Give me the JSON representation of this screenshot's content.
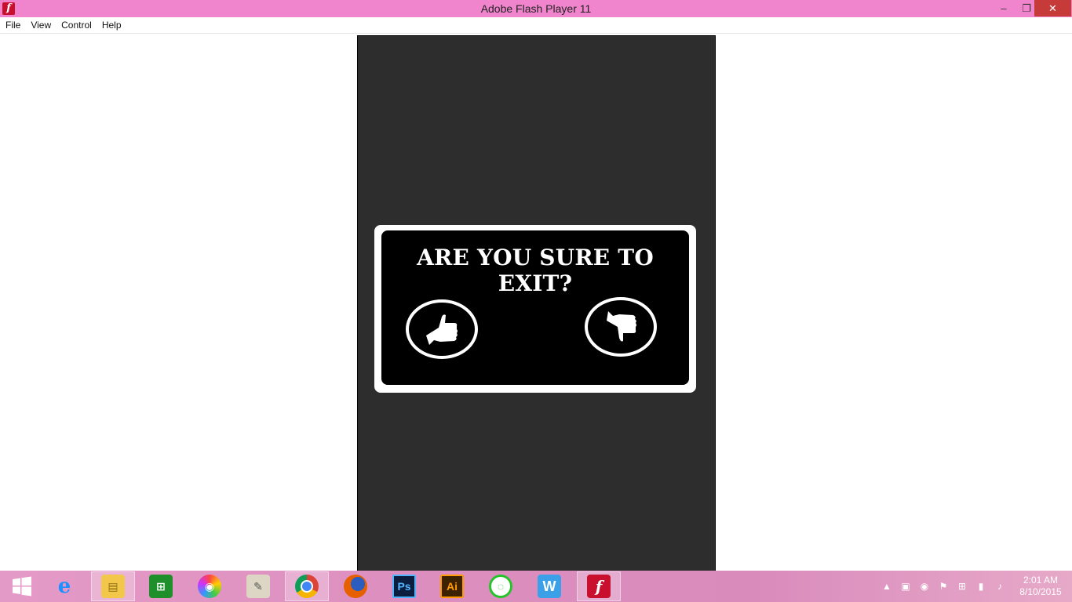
{
  "window": {
    "title": "Adobe Flash Player 11",
    "app_icon_glyph": "f",
    "minimize": "–",
    "maximize": "❐",
    "close": "✕"
  },
  "menu": {
    "items": [
      "File",
      "View",
      "Control",
      "Help"
    ]
  },
  "dialog": {
    "title": "ARE YOU SURE TO EXIT?",
    "yes_icon": "thumbs-up-icon",
    "no_icon": "thumbs-down-icon"
  },
  "taskbar": {
    "apps": [
      {
        "name": "windows-start-icon",
        "glyph": "⊞"
      },
      {
        "name": "internet-explorer-icon",
        "glyph": "e"
      },
      {
        "name": "file-explorer-icon",
        "glyph": "▤"
      },
      {
        "name": "windows-store-icon",
        "glyph": "⊞"
      },
      {
        "name": "color-app-icon",
        "glyph": "◉"
      },
      {
        "name": "paper-app-icon",
        "glyph": "✎"
      },
      {
        "name": "chrome-icon",
        "glyph": "◎"
      },
      {
        "name": "firefox-icon",
        "glyph": "◍"
      },
      {
        "name": "photoshop-icon",
        "glyph": "Ps"
      },
      {
        "name": "illustrator-icon",
        "glyph": "Ai"
      },
      {
        "name": "line-chat-icon",
        "glyph": "◌"
      },
      {
        "name": "wps-icon",
        "glyph": "W"
      },
      {
        "name": "flash-player-icon",
        "glyph": "f"
      }
    ],
    "clock_time": "2:01 AM",
    "clock_date": "8/10/2015"
  },
  "colors": {
    "titlebar": "#f185cd",
    "stage": "#2d2d2d",
    "dialog_bg": "#000000",
    "close_button": "#c73a3a"
  }
}
